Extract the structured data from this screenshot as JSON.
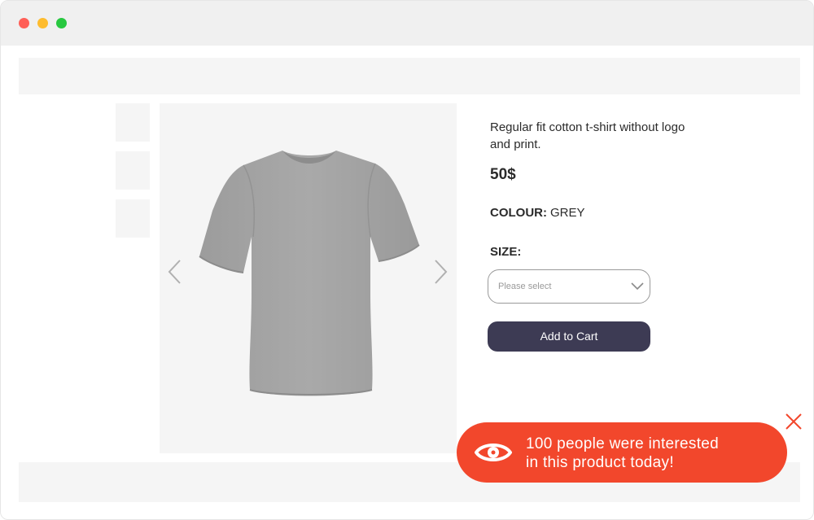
{
  "window": {
    "controls": [
      "close",
      "minimize",
      "maximize"
    ]
  },
  "product": {
    "title": "Regular fit cotton t-shirt without logo and print.",
    "price": "50$",
    "colour_label": "COLOUR:",
    "colour_value": "GREY",
    "size_label": "SIZE:",
    "size_placeholder": "Please select",
    "add_to_cart": "Add to Cart"
  },
  "gallery": {
    "thumbnail_count": 3,
    "prev_icon": "chevron-left-icon",
    "next_icon": "chevron-right-icon"
  },
  "notification": {
    "line1": "100 people were interested",
    "line2": "in this product today!",
    "icon": "eye-icon",
    "close_icon": "close-icon"
  },
  "colors": {
    "accent": "#f2472c",
    "button": "#3d3b54",
    "placeholder_bg": "#f5f5f5"
  }
}
